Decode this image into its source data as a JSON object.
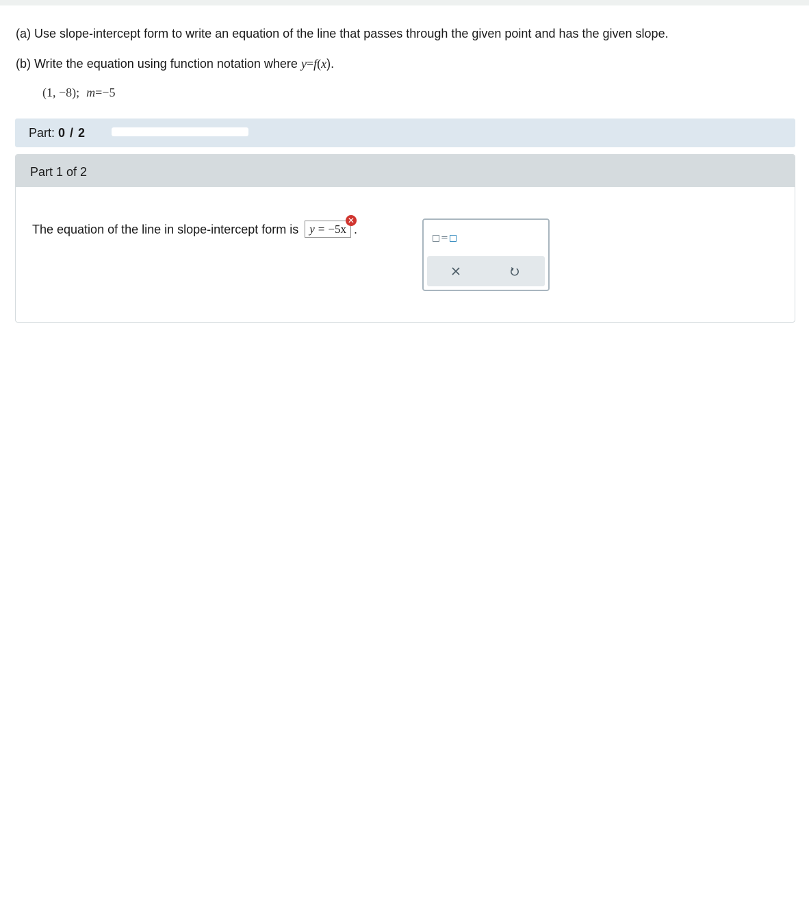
{
  "question": {
    "part_a": "(a) Use slope-intercept form to write an equation of the line that passes through the given point and has the given slope.",
    "part_b_prefix": "(b) Write the equation using function notation where",
    "part_b_y": "y",
    "part_b_equals": "=",
    "part_b_f": "f",
    "part_b_open": "(",
    "part_b_x": "x",
    "part_b_close": ").",
    "given_point": "(1, −8);",
    "given_m": "m",
    "given_eq": "=",
    "given_slope": "−5"
  },
  "progress": {
    "label": "Part:",
    "value": "0 / 2",
    "fraction": 0
  },
  "part": {
    "header": "Part 1 of 2",
    "prompt": "The equation of the line in slope-intercept form is",
    "answer_var": "y",
    "answer_eq": "=",
    "answer_value": "−5x",
    "answer_status": "incorrect",
    "period": "."
  },
  "toolbox": {
    "equals_glyph": "=",
    "clear_icon": "close-icon",
    "undo_icon": "undo-icon"
  },
  "colors": {
    "error": "#d0352f",
    "progress_bg": "#dde7ef",
    "part_header_bg": "#d5dbde"
  }
}
